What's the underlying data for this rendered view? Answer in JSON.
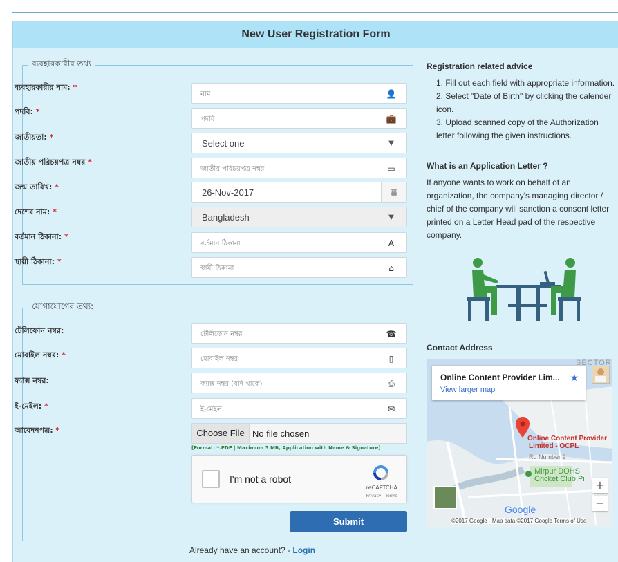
{
  "form": {
    "title": "New User Registration Form",
    "section_user": "ব্যবহারকারীর তথ্য",
    "section_contact": "যোগাযোগের তথ্য:",
    "user_fields": [
      {
        "label": "ব্যবহারকারীর নাম:",
        "placeholder": "নাম",
        "icon": "user-icon"
      },
      {
        "label": "পদবি:",
        "placeholder": "পদবি",
        "icon": "briefcase-icon"
      },
      {
        "label": "জাতীয়তা:",
        "value": "Select one",
        "icon": "caret-down-icon"
      },
      {
        "label": "জাতীয় পরিচয়পত্র নম্বর",
        "placeholder": "জাতীয় পরিচয়পত্র নম্বর",
        "icon": "id-card-icon"
      },
      {
        "label": "জন্ম তারিখ:",
        "value": "26-Nov-2017",
        "icon": "calendar-icon"
      },
      {
        "label": "দেশের নাম:",
        "value": "Bangladesh",
        "icon": "caret-down-icon"
      },
      {
        "label": "বর্তমান ঠিকানা:",
        "placeholder": "বর্তমান ঠিকানা",
        "icon": "road-icon"
      },
      {
        "label": "স্থায়ী ঠিকানা:",
        "placeholder": "স্থায়ী ঠিকানা",
        "icon": "home-icon"
      }
    ],
    "contact_fields": [
      {
        "label": "টেলিফোন নম্বর:",
        "placeholder": "টেলিফোন নম্বর",
        "icon": "phone-icon",
        "required": false
      },
      {
        "label": "মোবাইল নম্বর:",
        "placeholder": "মোবাইল নম্বর",
        "icon": "mobile-icon",
        "required": true
      },
      {
        "label": "ফ্যাক্স নম্বর:",
        "placeholder": "ফ্যাক্স নম্বর (যদি থাকে)",
        "icon": "fax-icon",
        "required": false
      },
      {
        "label": "ই-মেইল:",
        "placeholder": "ই-মেইল",
        "icon": "envelope-icon",
        "required": true
      }
    ],
    "application_label": "আবেদনপত্র:",
    "required_mark": "*",
    "file_button": "Choose File",
    "file_status": "No file chosen",
    "file_note": "[Format: *.PDF | Maximum 3 MB, Application with Name & Signature]",
    "captcha_text": "I'm not a robot",
    "captcha_brand": "reCAPTCHA",
    "captcha_terms": "Privacy - Terms",
    "submit": "Submit",
    "already_text": "Already have an account? - ",
    "login_link": "Login"
  },
  "sidebar": {
    "advice_title": "Registration related advice",
    "advice_items": [
      "1. Fill out each field with appropriate information.",
      "2. Select \"Date of Birth\" by clicking the calender icon.",
      "3. Upload scanned copy of the Authorization letter following the given instructions."
    ],
    "letter_title": "What is an Application Letter ?",
    "letter_text": "If anyone wants to work on behalf of an organization, the company's managing director / chief of the company will sanction a consent letter printed on a Letter Head pad of the respective company.",
    "contact_title": "Contact Address"
  },
  "map": {
    "place_name": "Online Content Provider Lim...",
    "view_larger": "View larger map",
    "pin_label_1": "Online Content Provider",
    "pin_label_2": "Limited - OCPL",
    "road_label": "Rd Number 9",
    "sector_label": "SECTOR",
    "park_label_1": "Mirpur DOHS",
    "park_label_2": "Cricket Club Pi",
    "google": "Google",
    "footer": "©2017 Google - Map data ©2017 Google   Terms of Use",
    "zoom_in": "+",
    "zoom_out": "−"
  },
  "colors": {
    "header_bg": "#aee2f6",
    "panel_bg": "#daf1fa",
    "submit_bg": "#2f6db3",
    "required": "#d9252a",
    "illustration": "#3f9a47",
    "illustration_dark": "#35607f"
  }
}
